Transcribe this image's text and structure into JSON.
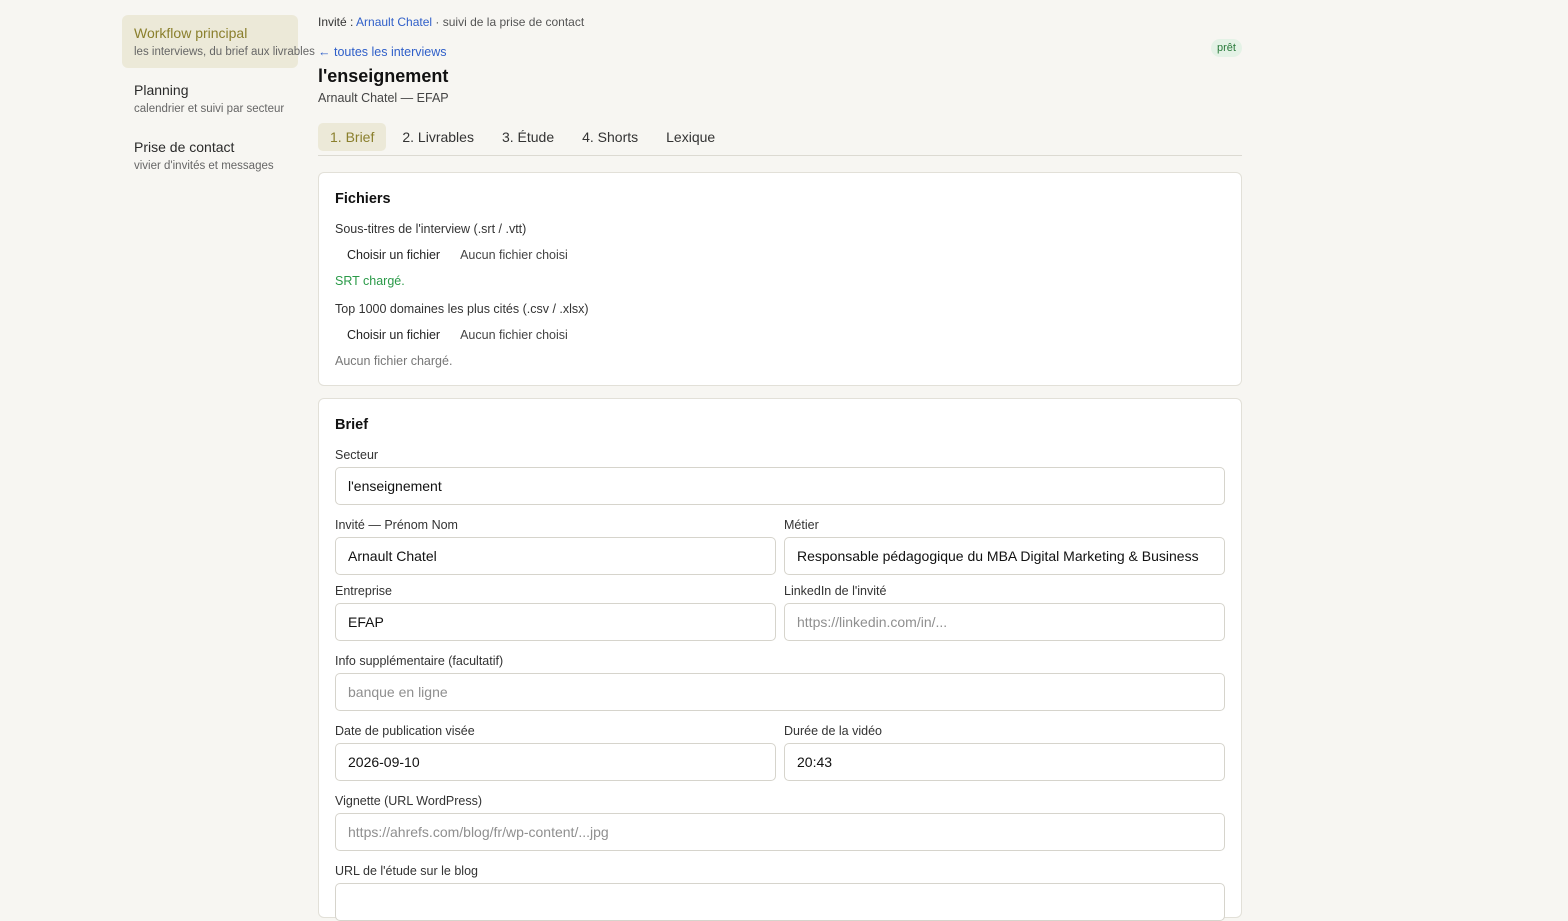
{
  "sidebar": {
    "items": [
      {
        "title": "Workflow principal",
        "sub": "les interviews, du brief aux livrables"
      },
      {
        "title": "Planning",
        "sub": "calendrier et suivi par secteur"
      },
      {
        "title": "Prise de contact",
        "sub": "vivier d'invités et messages"
      }
    ]
  },
  "header": {
    "guest_label": "Invité :",
    "guest_name": "Arnault Chatel",
    "guest_suffix": "· suivi de la prise de contact",
    "back_link": "← toutes les interviews",
    "status": "prêt",
    "title": "l'enseignement",
    "subtitle": "Arnault Chatel — EFAP"
  },
  "tabs": [
    "1. Brief",
    "2. Livrables",
    "3. Étude",
    "4. Shorts",
    "Lexique"
  ],
  "files": {
    "title": "Fichiers",
    "srt_label": "Sous-titres de l'interview (.srt / .vtt)",
    "choose_label": "Choisir un fichier",
    "none_chosen": "Aucun fichier choisi",
    "srt_status": "SRT chargé.",
    "top_label": "Top 1000 domaines les plus cités (.csv / .xlsx)",
    "top_status": "Aucun fichier chargé."
  },
  "brief": {
    "title": "Brief",
    "secteur_label": "Secteur",
    "secteur_value": "l'enseignement",
    "invite_label": "Invité — Prénom Nom",
    "invite_value": "Arnault Chatel",
    "metier_label": "Métier",
    "metier_value": "Responsable pédagogique du MBA Digital Marketing & Business",
    "entreprise_label": "Entreprise",
    "entreprise_value": "EFAP",
    "linkedin_label": "LinkedIn de l'invité",
    "linkedin_placeholder": "https://linkedin.com/in/...",
    "info_label": "Info supplémentaire (facultatif)",
    "info_placeholder": "banque en ligne",
    "date_label": "Date de publication visée",
    "date_value": "2026-09-10",
    "duree_label": "Durée de la vidéo",
    "duree_value": "20:43",
    "vignette_label": "Vignette (URL WordPress)",
    "vignette_placeholder": "https://ahrefs.com/blog/fr/wp-content/...jpg",
    "etude_label": "URL de l'étude sur le blog"
  }
}
